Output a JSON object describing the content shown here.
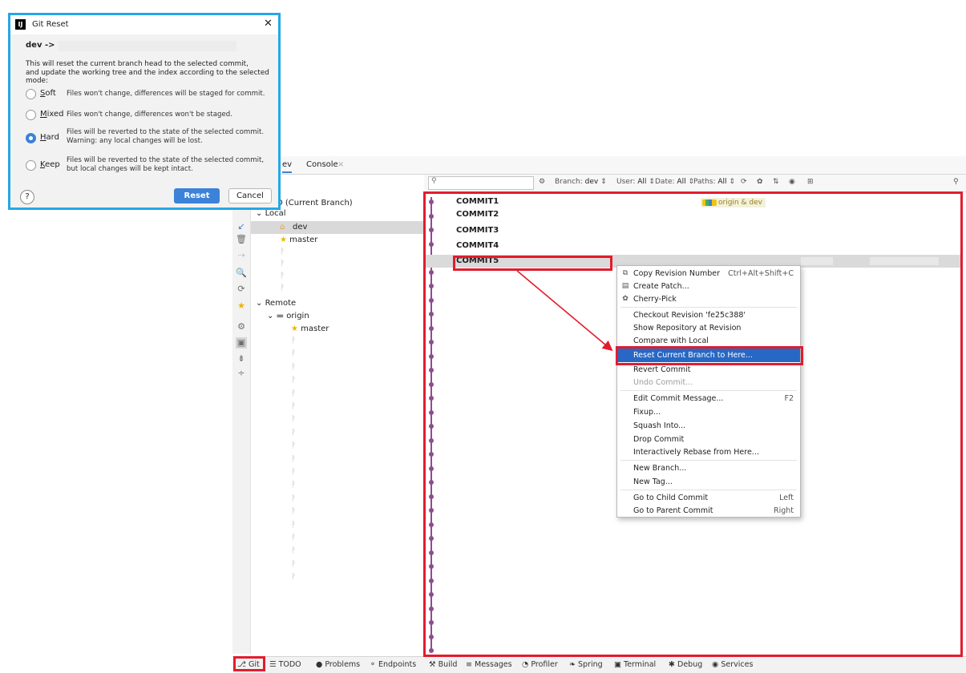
{
  "dialog": {
    "title": "Git Reset",
    "branch_line": "dev ->",
    "description_1": "This will reset the current branch head to the selected commit,",
    "description_2": "and update the working tree and the index according to the selected mode:",
    "options": [
      {
        "label": "Soft",
        "desc_1": "Files won't change, differences will be staged for commit.",
        "desc_2": "",
        "selected": false
      },
      {
        "label": "Mixed",
        "desc_1": "Files won't change, differences won't be staged.",
        "desc_2": "",
        "selected": false
      },
      {
        "label": "Hard",
        "desc_1": "Files will be reverted to the state of the selected commit.",
        "desc_2": "Warning: any local changes will be lost.",
        "selected": true
      },
      {
        "label": "Keep",
        "desc_1": "Files will be reverted to the state of the selected commit,",
        "desc_2": "but local changes will be kept intact.",
        "selected": false
      }
    ],
    "help": "?",
    "reset_button": "Reset",
    "cancel_button": "Cancel"
  },
  "tabs": [
    {
      "label": "ev"
    },
    {
      "label": "Console"
    }
  ],
  "filter_bar": {
    "branch_prefix": "Branch:",
    "branch_value": "dev",
    "user_prefix": "User:",
    "user_value": "All",
    "date_prefix": "Date:",
    "date_value": "All",
    "paths_prefix": "Paths:",
    "paths_value": "All"
  },
  "tree": {
    "head": "D (Current Branch)",
    "local": "Local",
    "local_branches": [
      "dev",
      "master"
    ],
    "remote": "Remote",
    "origin": "origin",
    "origin_branch": "master"
  },
  "commits": [
    "COMMIT1",
    "COMMIT2",
    "COMMIT3",
    "COMMIT4",
    "COMMIT5"
  ],
  "tag_label": "origin & dev",
  "context_menu": {
    "items": [
      {
        "label": "Copy Revision Number",
        "shortcut": "Ctrl+Alt+Shift+C",
        "icon": "copy-icon"
      },
      {
        "label": "Create Patch...",
        "shortcut": "",
        "icon": "patch-icon"
      },
      {
        "label": "Cherry-Pick",
        "shortcut": "",
        "icon": "cherry-icon"
      },
      {
        "label": "Checkout Revision 'fe25c388'",
        "shortcut": ""
      },
      {
        "label": "Show Repository at Revision",
        "shortcut": ""
      },
      {
        "label": "Compare with Local",
        "shortcut": ""
      },
      {
        "label": "Reset Current Branch to Here...",
        "shortcut": "",
        "selected": true
      },
      {
        "label": "Revert Commit",
        "shortcut": ""
      },
      {
        "label": "Undo Commit...",
        "shortcut": "",
        "disabled": true
      },
      {
        "label": "Edit Commit Message...",
        "shortcut": "F2"
      },
      {
        "label": "Fixup...",
        "shortcut": ""
      },
      {
        "label": "Squash Into...",
        "shortcut": ""
      },
      {
        "label": "Drop Commit",
        "shortcut": ""
      },
      {
        "label": "Interactively Rebase from Here...",
        "shortcut": ""
      },
      {
        "label": "New Branch...",
        "shortcut": ""
      },
      {
        "label": "New Tag...",
        "shortcut": ""
      },
      {
        "label": "Go to Child Commit",
        "shortcut": "Left"
      },
      {
        "label": "Go to Parent Commit",
        "shortcut": "Right"
      }
    ]
  },
  "status_bar": [
    "Git",
    "TODO",
    "Problems",
    "Endpoints",
    "Build",
    "Messages",
    "Profiler",
    "Spring",
    "Terminal",
    "Debug",
    "Services"
  ],
  "colors": {
    "highlight": "#e21c2e",
    "dialog_border": "#25a7e7",
    "selection": "#2768c4",
    "graph": "#8e4d8e"
  }
}
